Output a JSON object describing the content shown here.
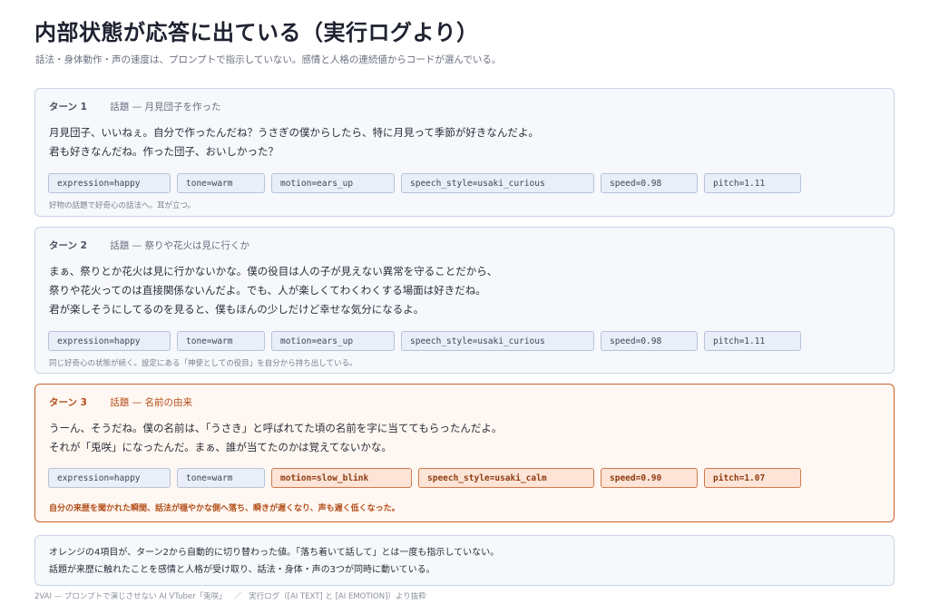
{
  "header": {
    "title": "内部状態が応答に出ている（実行ログより）",
    "subtitle": "話法・身体動作・声の速度は、プロンプトで指示していない。感情と人格の連続値からコードが選んでいる。"
  },
  "turns": [
    {
      "label": "ターン 1",
      "topic": "話題 — 月見団子を作った",
      "lines": [
        "月見団子、いいねぇ。自分で作ったんだね？うさぎの僕からしたら、特に月見って季節が好きなんだよ。",
        "君も好きなんだね。作った団子、おいしかった？"
      ],
      "tags": [
        "expression=happy",
        "tone=warm",
        "motion=ears_up",
        "speech_style=usaki_curious",
        "speed=0.98",
        "pitch=1.11"
      ],
      "note": "好物の話題で好奇心の話法へ。耳が立つ。"
    },
    {
      "label": "ターン 2",
      "topic": "話題 — 祭りや花火は見に行くか",
      "lines": [
        "まぁ、祭りとか花火は見に行かないかな。僕の役目は人の子が見えない異常を守ることだから、",
        "祭りや花火ってのは直接関係ないんだよ。でも、人が楽しくてわくわくする場面は好きだね。",
        "君が楽しそうにしてるのを見ると、僕もほんの少しだけど幸せな気分になるよ。"
      ],
      "tags": [
        "expression=happy",
        "tone=warm",
        "motion=ears_up",
        "speech_style=usaki_curious",
        "speed=0.98",
        "pitch=1.11"
      ],
      "note": "同じ好奇心の状態が続く。設定にある「神使としての役目」を自分から持ち出している。"
    },
    {
      "label": "ターン 3",
      "topic": "話題 — 名前の由来",
      "lines": [
        "うーん、そうだね。僕の名前は、「うさき」と呼ばれてた頃の名前を字に当ててもらったんだよ。",
        "それが「兎咲」になったんだ。まぁ、誰が当てたのかは覚えてないかな。"
      ],
      "tags": [
        "expression=happy",
        "tone=warm",
        "motion=slow_blink",
        "speech_style=usaki_calm",
        "speed=0.90",
        "pitch=1.07"
      ],
      "changed": [
        false,
        false,
        true,
        true,
        true,
        true
      ],
      "note": "自分の来歴を聞かれた瞬間、話法が穏やかな側へ落ち、瞬きが遅くなり、声も遅く低くなった。"
    }
  ],
  "summary": {
    "lines": [
      "オレンジの4項目が、ターン2から自動的に切り替わった値。「落ち着いて話して」とは一度も指示していない。",
      "話題が来歴に触れたことを感情と人格が受け取り、話法・身体・声の3つが同時に動いている。"
    ]
  },
  "footer": {
    "left": "2VAI — プロンプトで演じさせない AI VTuber「兎咲」",
    "sep": "／",
    "right": "実行ログ（[AI TEXT] と [AI EMOTION]）より抜粋"
  }
}
